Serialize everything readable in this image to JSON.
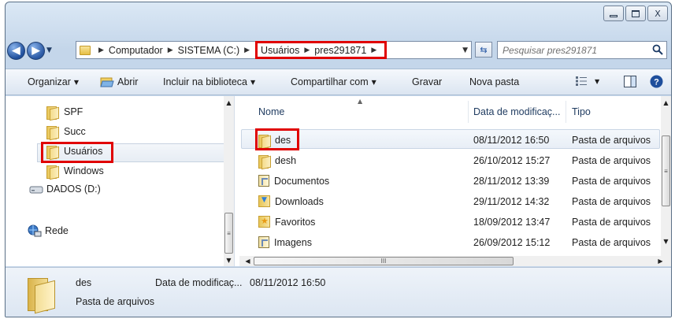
{
  "window": {
    "minimize_glyph": "▭",
    "maximize_glyph": "⧉",
    "close_glyph": "X"
  },
  "address": {
    "crumbs": [
      "Computador",
      "SISTEMA (C:)",
      "Usuários",
      "pres291871"
    ],
    "search_placeholder": "Pesquisar pres291871"
  },
  "toolbar": {
    "organize": "Organizar",
    "open": "Abrir",
    "include_library": "Incluir na biblioteca",
    "share": "Compartilhar com",
    "burn": "Gravar",
    "new_folder": "Nova pasta"
  },
  "nav": {
    "items": [
      {
        "label": "SPF",
        "icon": "folder-icon"
      },
      {
        "label": "Succ",
        "icon": "folder-icon"
      },
      {
        "label": "Usuários",
        "icon": "folder-icon",
        "selected": true
      },
      {
        "label": "Windows",
        "icon": "folder-icon"
      },
      {
        "label": "DADOS (D:)",
        "icon": "drive-icon"
      },
      {
        "label": "Rede",
        "icon": "network-icon"
      }
    ]
  },
  "files": {
    "columns": [
      "Nome",
      "Data de modificaç...",
      "Tipo"
    ],
    "rows": [
      {
        "name": "des",
        "date": "08/11/2012 16:50",
        "type": "Pasta de arquivos",
        "icon": "folder-icon",
        "selected": true
      },
      {
        "name": "desh",
        "date": "26/10/2012 15:27",
        "type": "Pasta de arquivos",
        "icon": "folder-icon"
      },
      {
        "name": "Documentos",
        "date": "28/11/2012 13:39",
        "type": "Pasta de arquivos",
        "icon": "documents-library-icon"
      },
      {
        "name": "Downloads",
        "date": "29/11/2012 14:32",
        "type": "Pasta de arquivos",
        "icon": "downloads-folder-icon"
      },
      {
        "name": "Favoritos",
        "date": "18/09/2012 13:47",
        "type": "Pasta de arquivos",
        "icon": "favorites-folder-icon"
      },
      {
        "name": "Imagens",
        "date": "26/09/2012 15:12",
        "type": "Pasta de arquivos",
        "icon": "pictures-library-icon"
      }
    ],
    "hscroll_mid": "III"
  },
  "details": {
    "name": "des",
    "date_label": "Data de modificaç...",
    "date_value": "08/11/2012 16:50",
    "type": "Pasta de arquivos"
  },
  "colors": {
    "highlight_border": "#e00000",
    "accent": "#2456a4"
  }
}
